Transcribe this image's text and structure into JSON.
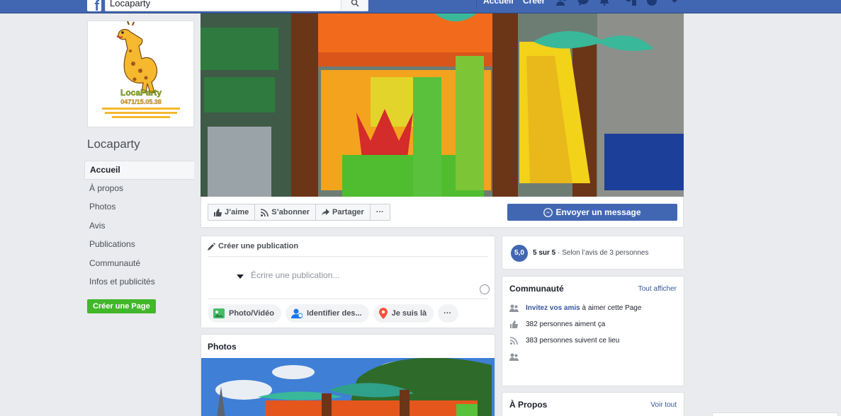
{
  "topbar": {
    "logo_letter": "f",
    "search_value": "Locaparty",
    "nav_home": "Accueil",
    "nav_create": "Créer"
  },
  "left": {
    "page_name": "Locaparty",
    "nav": [
      {
        "label": "Accueil",
        "active": true
      },
      {
        "label": "À propos"
      },
      {
        "label": "Photos"
      },
      {
        "label": "Avis"
      },
      {
        "label": "Publications"
      },
      {
        "label": "Communauté"
      },
      {
        "label": "Infos et publicités"
      }
    ],
    "create_page": "Créer une Page"
  },
  "cover_actions": {
    "like": "J’aime",
    "follow": "S’abonner",
    "share": "Partager",
    "more": "···",
    "message": "Envoyer un message"
  },
  "composer": {
    "title": "Créer une publication",
    "placeholder": "Écrire une publication...",
    "buttons": [
      "Photo/Vidéo",
      "Identifier des...",
      "Je suis là",
      "···"
    ]
  },
  "photos": {
    "title": "Photos"
  },
  "rating": {
    "score": "5,0",
    "label": "5 sur 5",
    "sub": "· Selon l’avis de 3 personnes"
  },
  "community": {
    "title": "Communauté",
    "see_all": "Tout afficher",
    "invite_link": "Invitez vos amis",
    "invite_rest": " à aimer cette Page",
    "likes": "382 personnes aiment ça",
    "follows": "383 personnes suivent ce lieu"
  },
  "about": {
    "title": "À Propos",
    "see_all": "Voir tout"
  },
  "colors": {
    "brand": "#4267b2",
    "green": "#42b72a",
    "link": "#365899"
  }
}
